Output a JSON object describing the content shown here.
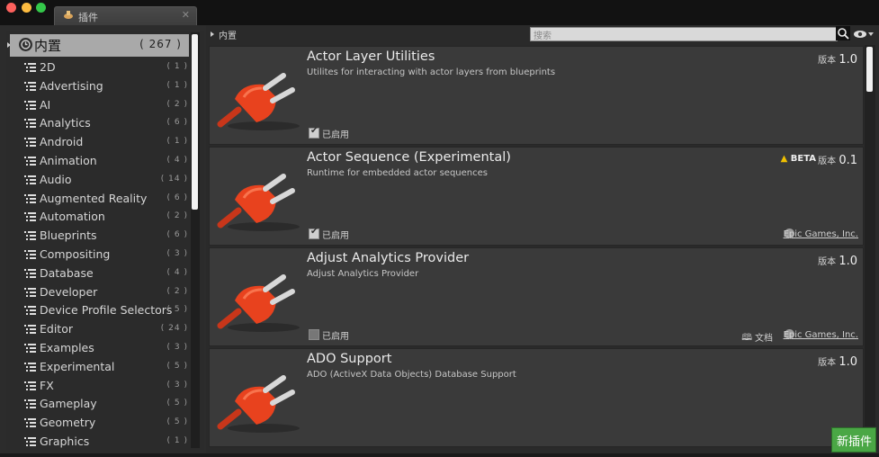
{
  "window": {
    "tab_title": "插件",
    "close_glyph": "✕",
    "lights": [
      "#fc615d",
      "#fdbc40",
      "#34c84a"
    ]
  },
  "sidebar": {
    "root": {
      "label": "内置",
      "count": "( 267 )"
    },
    "categories": [
      {
        "label": "2D",
        "count": "( 1 )"
      },
      {
        "label": "Advertising",
        "count": "( 1 )"
      },
      {
        "label": "AI",
        "count": "( 2 )"
      },
      {
        "label": "Analytics",
        "count": "( 6 )"
      },
      {
        "label": "Android",
        "count": "( 1 )"
      },
      {
        "label": "Animation",
        "count": "( 4 )"
      },
      {
        "label": "Audio",
        "count": "( 14 )"
      },
      {
        "label": "Augmented Reality",
        "count": "( 6 )"
      },
      {
        "label": "Automation",
        "count": "( 2 )"
      },
      {
        "label": "Blueprints",
        "count": "( 6 )"
      },
      {
        "label": "Compositing",
        "count": "( 3 )"
      },
      {
        "label": "Database",
        "count": "( 4 )"
      },
      {
        "label": "Developer",
        "count": "( 2 )"
      },
      {
        "label": "Device Profile Selectors",
        "count": "( 5 )"
      },
      {
        "label": "Editor",
        "count": "( 24 )"
      },
      {
        "label": "Examples",
        "count": "( 3 )"
      },
      {
        "label": "Experimental",
        "count": "( 5 )"
      },
      {
        "label": "FX",
        "count": "( 3 )"
      },
      {
        "label": "Gameplay",
        "count": "( 5 )"
      },
      {
        "label": "Geometry",
        "count": "( 5 )"
      },
      {
        "label": "Graphics",
        "count": "( 1 )"
      }
    ]
  },
  "main": {
    "breadcrumb": "内置",
    "search": {
      "placeholder": "搜索"
    },
    "plugins": [
      {
        "title": "Actor Layer Utilities",
        "description": "Utilites for interacting with actor layers from blueprints",
        "version_label": "版本",
        "version": "1.0",
        "enabled_label": "已启用",
        "enabled": true
      },
      {
        "title": "Actor Sequence (Experimental)",
        "description": "Runtime for embedded actor sequences",
        "version_label": "版本",
        "version": "0.1",
        "beta": "BETA",
        "enabled_label": "已启用",
        "enabled": true,
        "vendor": "Epic Games, Inc."
      },
      {
        "title": "Adjust Analytics Provider",
        "description": "Adjust Analytics Provider",
        "version_label": "版本",
        "version": "1.0",
        "enabled_label": "已启用",
        "enabled": false,
        "docs": "文档",
        "vendor": "Epic Games, Inc."
      },
      {
        "title": "ADO Support",
        "description": "ADO (ActiveX Data Objects) Database Support",
        "version_label": "版本",
        "version": "1.0"
      }
    ],
    "new_plugin_button": "新插件"
  },
  "colors": {
    "plug": "#e8421e",
    "new_button": "#4aa745",
    "beta_warning": "#f0c000"
  }
}
